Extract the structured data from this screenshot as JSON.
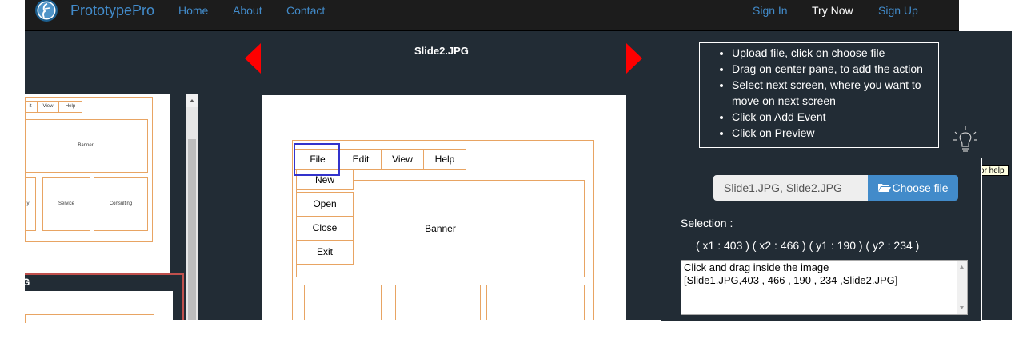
{
  "navbar": {
    "brand": "PrototypePro",
    "links": [
      "Home",
      "About",
      "Contact"
    ],
    "sign_in": "Sign In",
    "try_now": "Try Now",
    "sign_up": "Sign Up",
    "logo_letter": "P"
  },
  "slide": {
    "name": "Slide2.JPG"
  },
  "thumbnail": {
    "menu": [
      "it",
      "View",
      "Help"
    ],
    "banner": "Banner",
    "boxes": [
      "y",
      "Service",
      "Consulting"
    ],
    "second_label": "G"
  },
  "canvas": {
    "menu": [
      "File",
      "Edit",
      "View",
      "Help"
    ],
    "submenu": [
      "New",
      "Open",
      "Close",
      "Exit"
    ],
    "banner": "Banner"
  },
  "instructions": [
    "Upload file, click on choose file",
    "Drag on center pane, to add the action",
    "Select next screen, where you want to move on next screen",
    "Click on Add Event",
    "Click on Preview"
  ],
  "help": {
    "tooltip": "Click here for help"
  },
  "upload": {
    "files": "Slide1.JPG, Slide2.JPG",
    "choose_label": "Choose file"
  },
  "selection": {
    "label": "Selection :",
    "coords": "( x1 : 403 ) ( x2 : 466 ) ( y1 : 190 ) ( y2 : 234 )"
  },
  "result": {
    "line1": "Click and drag inside the image",
    "line2": "[Slide1.JPG,403 , 466 , 190 , 234 ,Slide2.JPG]"
  },
  "colors": {
    "accent": "#428bca",
    "nav_bg": "#1c1c1c",
    "panel_bg": "#222c35",
    "arrow": "#ff0000",
    "wireframe": "#e8a463",
    "selection": "#3333cc"
  }
}
